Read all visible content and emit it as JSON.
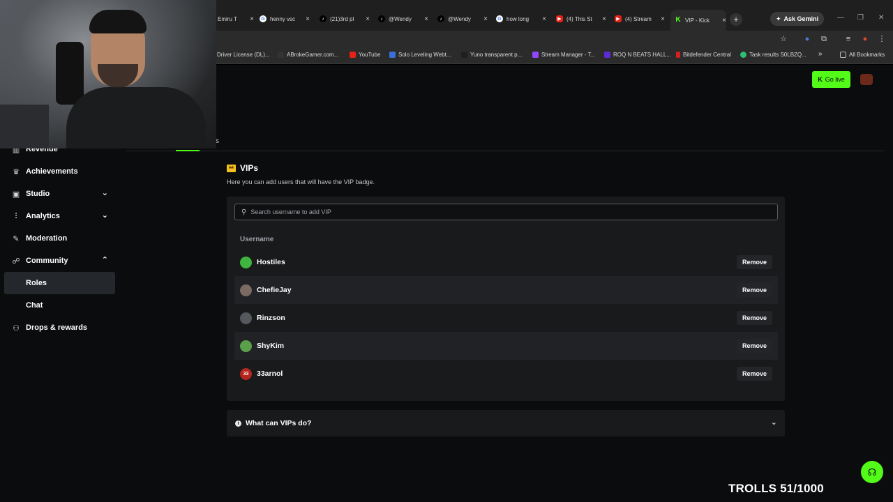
{
  "browser": {
    "tabs": [
      {
        "title": "Emiru T",
        "fav": "tt",
        "icon": "twitch-icon"
      },
      {
        "title": "henny vsc",
        "fav": "g",
        "icon": "google-icon"
      },
      {
        "title": "(21)3rd pl",
        "fav": "tt",
        "icon": "tiktok-icon"
      },
      {
        "title": "@Wendy",
        "fav": "tt",
        "icon": "tiktok-icon"
      },
      {
        "title": "@Wendy",
        "fav": "tt",
        "icon": "tiktok-icon"
      },
      {
        "title": "how long",
        "fav": "g",
        "icon": "google-icon"
      },
      {
        "title": "(4) This St",
        "fav": "yt",
        "icon": "youtube-icon"
      },
      {
        "title": "(4) Stream",
        "fav": "yt",
        "icon": "youtube-icon"
      },
      {
        "title": "VIP - Kick",
        "fav": "k",
        "icon": "kick-icon",
        "active": true
      }
    ],
    "ask_gemini": "Ask Gemini",
    "bookmarks": [
      "Driver License (DL)...",
      "ABrokeGamer.com...",
      "YouTube",
      "Solo Leveling Webt...",
      "Yuno transparent p...",
      "Stream Manager - T...",
      "ROQ N BEATS HALL...",
      "Bitdefender Central",
      "Task results S0LBZQ...",
      "»",
      "All Bookmarks"
    ]
  },
  "header": {
    "go_live": "Go live",
    "tab_fragment": "s"
  },
  "sidebar": {
    "items": [
      {
        "label": "Revenue",
        "icon": "dollar-icon"
      },
      {
        "label": "Achievements",
        "icon": "trophy-icon"
      },
      {
        "label": "Studio",
        "icon": "studio-icon"
      },
      {
        "label": "Analytics",
        "icon": "chart-icon"
      },
      {
        "label": "Moderation",
        "icon": "wrench-icon"
      },
      {
        "label": "Community",
        "icon": "people-icon"
      },
      {
        "label": "Roles"
      },
      {
        "label": "Chat"
      },
      {
        "label": "Drops & rewards",
        "icon": "drops-icon"
      }
    ]
  },
  "vips": {
    "title": "VIPs",
    "subtitle": "Here you can add users that will have the VIP badge.",
    "search_placeholder": "Search username to add VIP",
    "column_header": "Username",
    "remove_label": "Remove",
    "users": [
      {
        "name": "Hostiles",
        "avatar_color": "#3fb43f",
        "avatar_text": ""
      },
      {
        "name": "ChefieJay",
        "avatar_color": "#7a6a62",
        "avatar_text": ""
      },
      {
        "name": "Rinzson",
        "avatar_color": "#55585c",
        "avatar_text": ""
      },
      {
        "name": "ShyKim",
        "avatar_color": "#5aa04a",
        "avatar_text": ""
      },
      {
        "name": "33arnol",
        "avatar_color": "#b3261e",
        "avatar_text": "33"
      }
    ]
  },
  "faq": {
    "label": "What can VIPs do?"
  },
  "overlay": {
    "trolls": "TROLLS 51/1000"
  },
  "colors": {
    "accent": "#53fc18",
    "background": "#0b0c0d",
    "panel": "#181a1c"
  }
}
